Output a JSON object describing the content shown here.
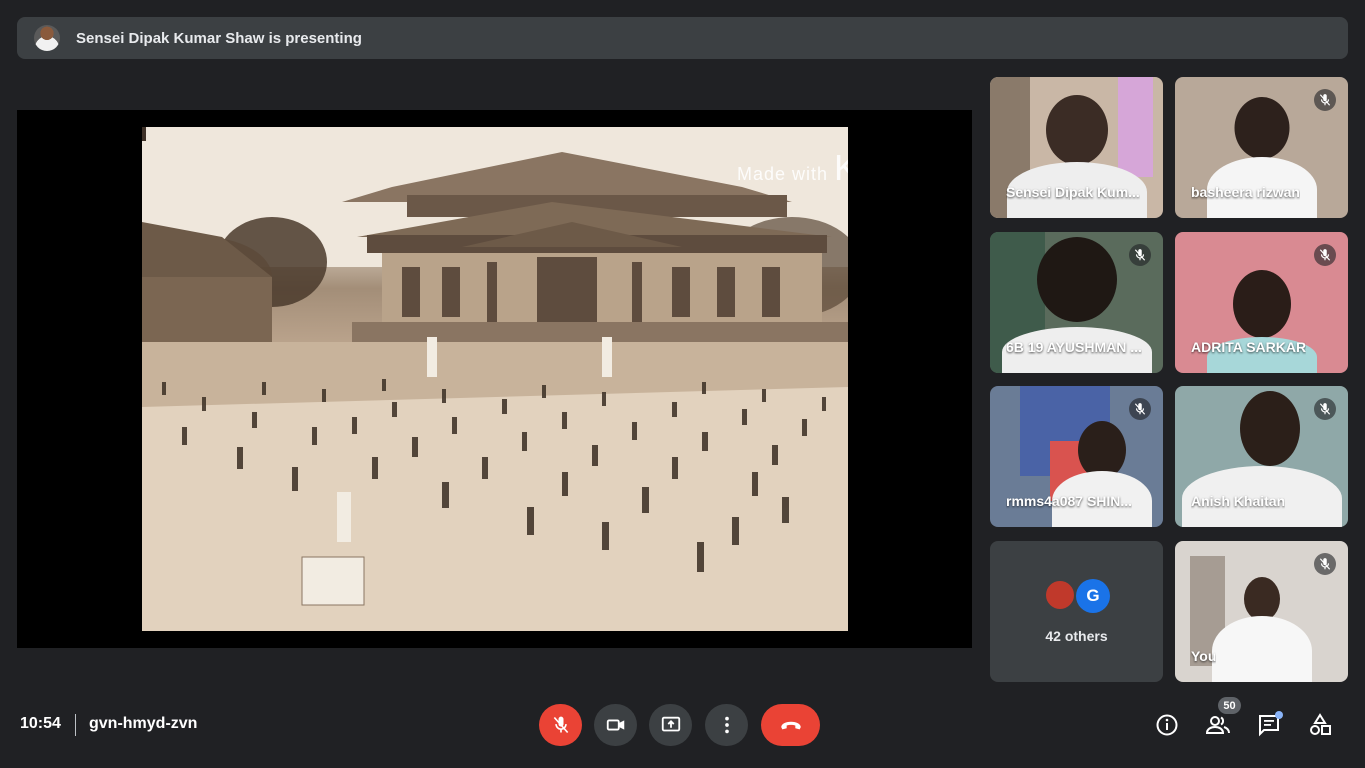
{
  "banner": {
    "presenter_text": "Sensei Dipak Kumar Shaw is presenting"
  },
  "stage": {
    "watermark_prefix": "Made with",
    "watermark_brand": "KINEMASTER"
  },
  "tiles": [
    {
      "name": "Sensei Dipak Kum...",
      "muted": false
    },
    {
      "name": "basheera rizwan",
      "muted": true
    },
    {
      "name": "6B 19 AYUSHMAN ...",
      "muted": true
    },
    {
      "name": "ADRITA SARKAR",
      "muted": true
    },
    {
      "name": "rmms4a087 SHIN...",
      "muted": true
    },
    {
      "name": "Anish Khaitan",
      "muted": true
    },
    {
      "name": "42 others",
      "avatar_letter": "G"
    },
    {
      "name": "You",
      "muted": true
    }
  ],
  "bottom": {
    "time": "10:54",
    "meeting_code": "gvn-hmyd-zvn",
    "participants_count": "50"
  },
  "colors": {
    "end_call": "#ea4335",
    "mic_off": "#ea4335",
    "control_bg": "#3c4043",
    "background": "#202124",
    "avatar_g": "#1a73e8"
  },
  "icons": [
    "mic-off-icon",
    "camera-icon",
    "present-screen-icon",
    "more-options-icon",
    "end-call-icon",
    "info-icon",
    "people-icon",
    "chat-icon",
    "activities-icon"
  ]
}
